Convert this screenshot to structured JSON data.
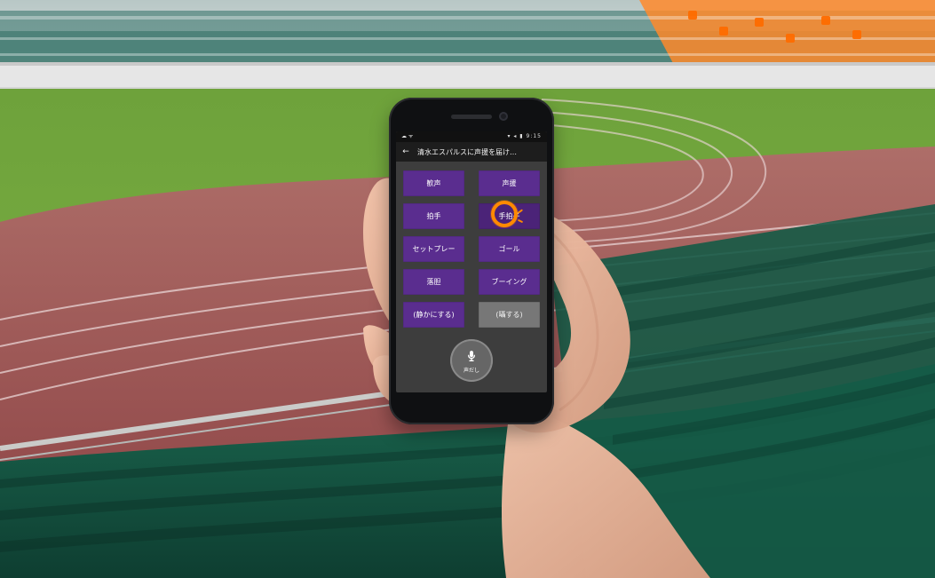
{
  "screen": {
    "status_left": "☁ ᯤ",
    "status_right": "▾ ◂ ▮ 9:15",
    "title": "清水エスパルスに声援を届け…",
    "buttons": [
      {
        "label": "歓声"
      },
      {
        "label": "声援"
      },
      {
        "label": "拍手"
      },
      {
        "label": "手拍子"
      },
      {
        "label": "セットプレー"
      },
      {
        "label": "ゴール"
      },
      {
        "label": "落胆"
      },
      {
        "label": "ブーイング"
      },
      {
        "label": "(静かにする)"
      },
      {
        "label": "(囁する)"
      }
    ],
    "mic_label": "声だし"
  },
  "colors": {
    "purple": "#5a2d8f",
    "gray_button": "#777777",
    "screen_bg": "#3d3d3d",
    "highlight_ring": "#ff8a00"
  },
  "icons": {
    "back": "back-arrow-icon",
    "mic": "microphone-icon",
    "tap": "tap-highlight-icon"
  }
}
